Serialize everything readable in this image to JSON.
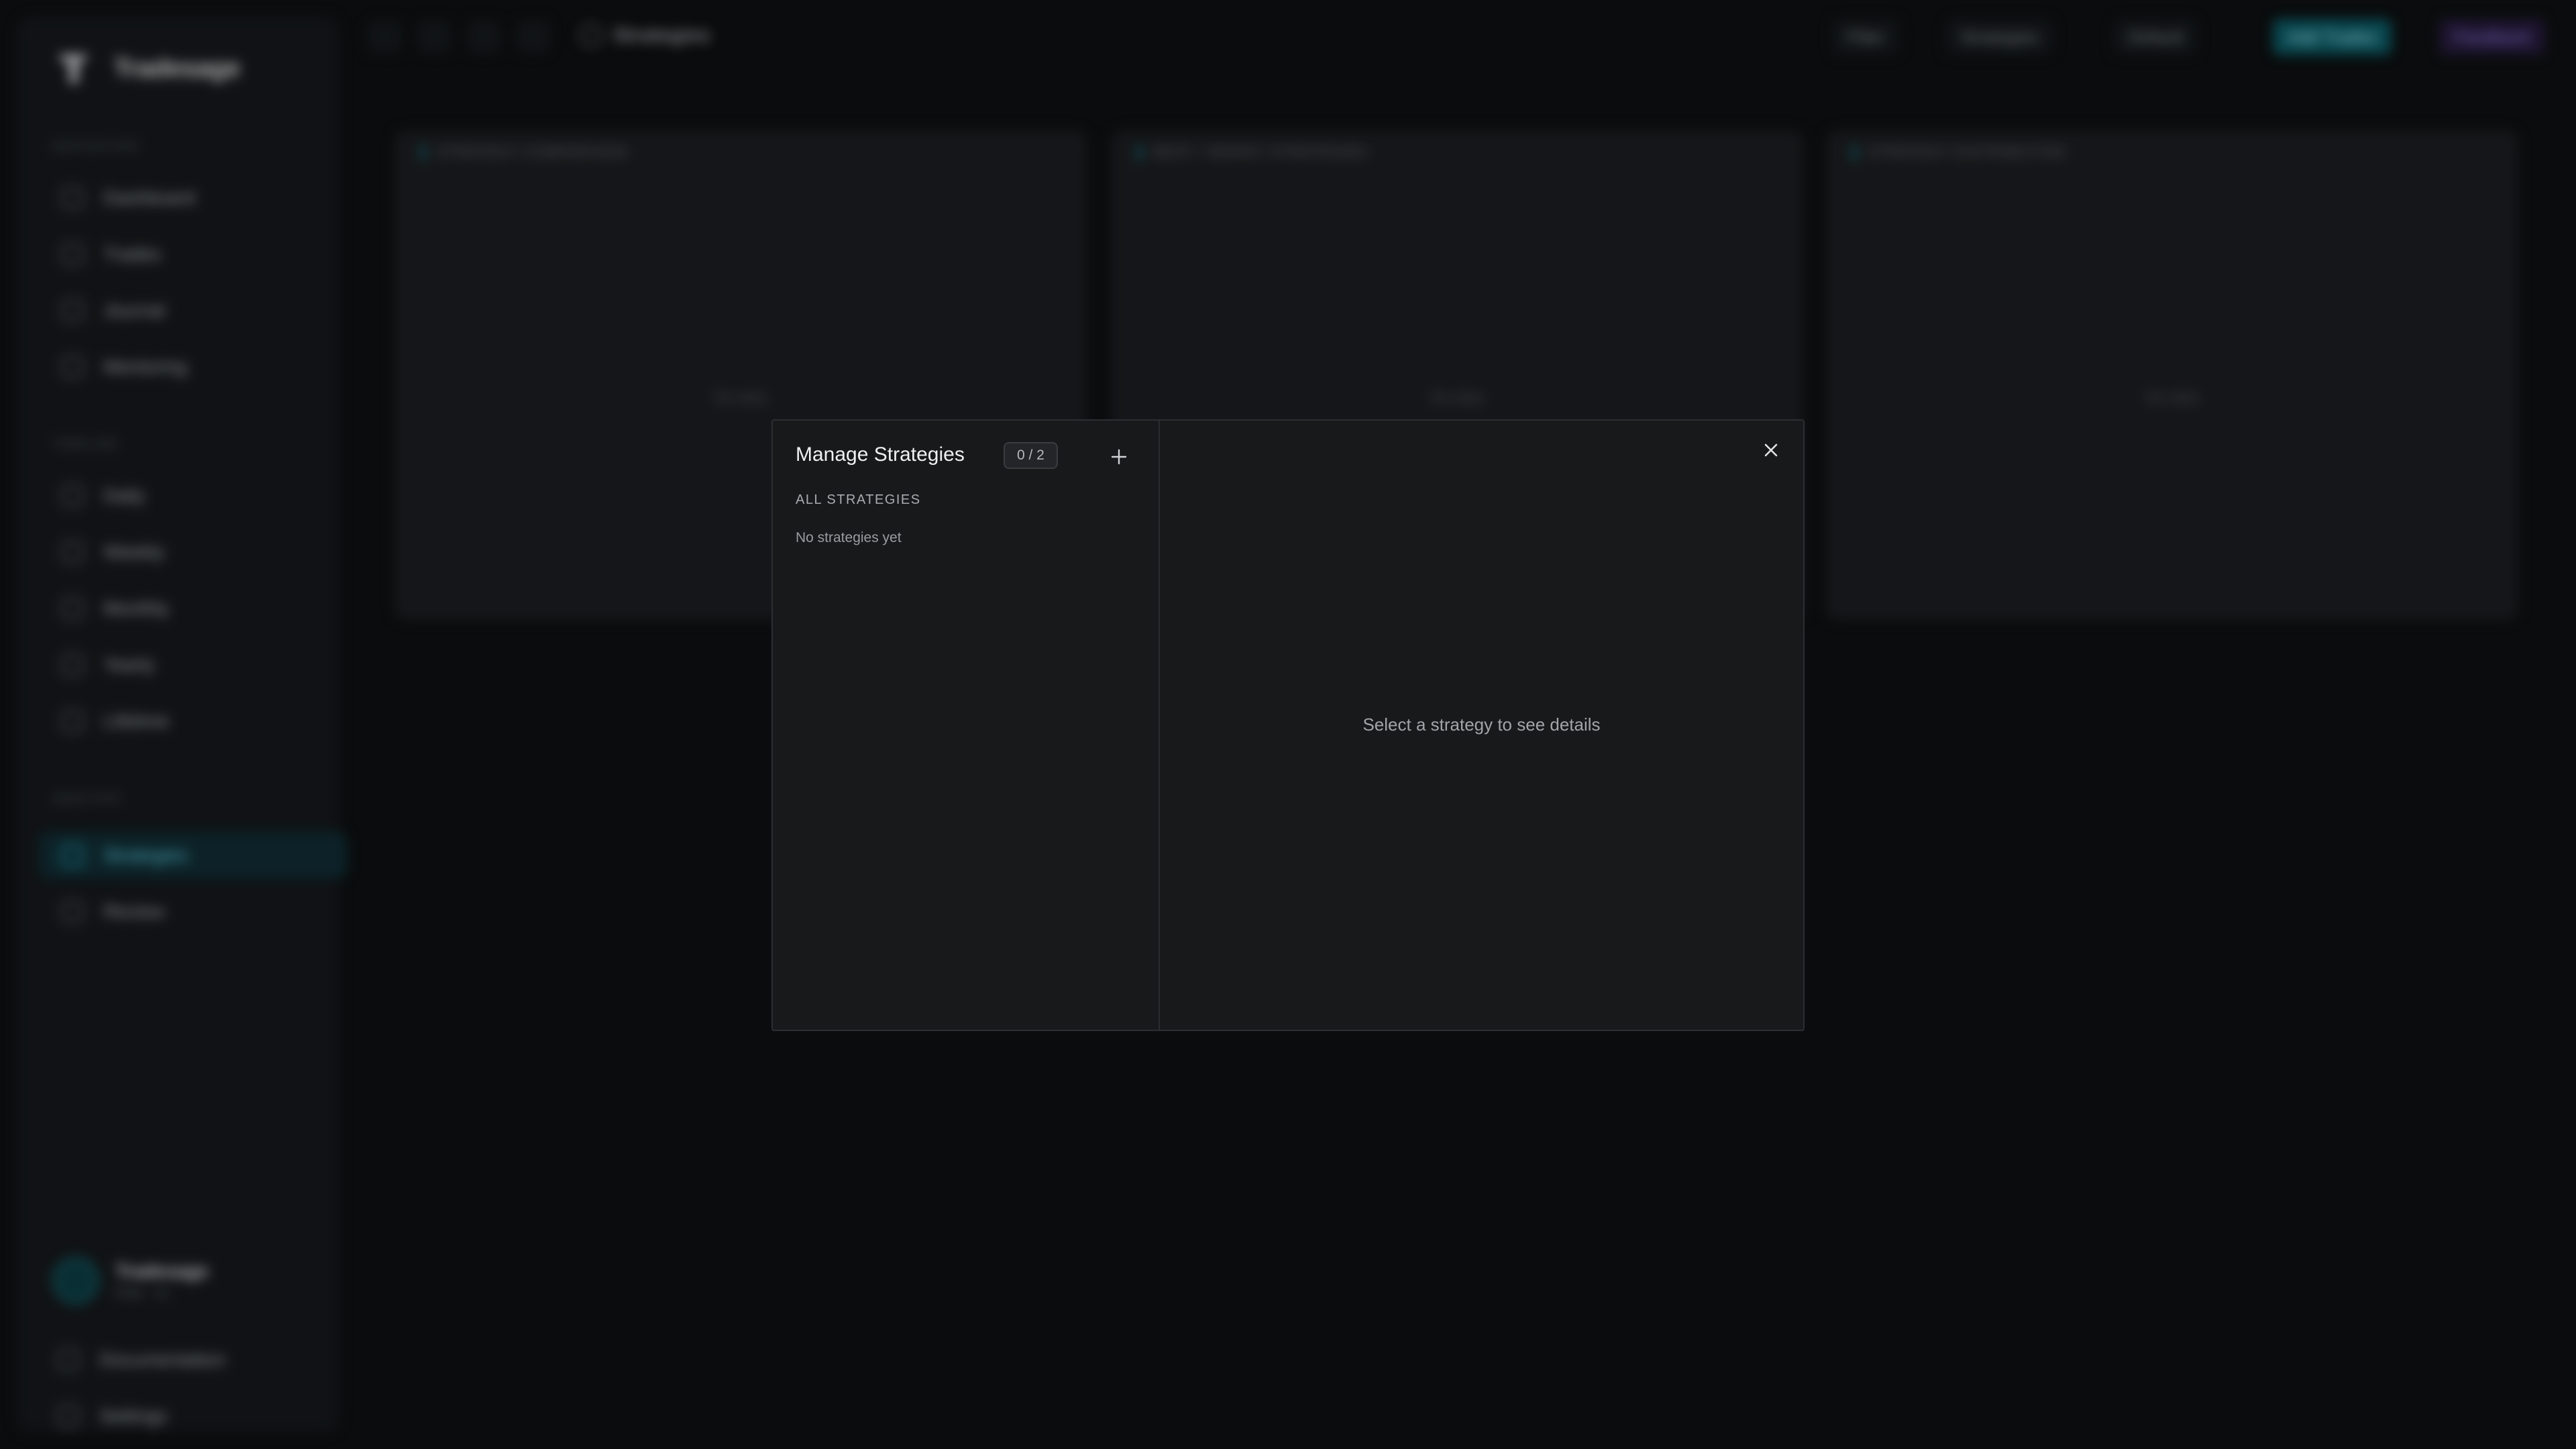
{
  "app": {
    "brand": "Tradesage",
    "breadcrumb": "Strategies"
  },
  "sidebar": {
    "sections": [
      {
        "label": "NAVIGATION"
      },
      {
        "label": "TIMELINE"
      },
      {
        "label": "ANALYSIS"
      }
    ],
    "items": [
      {
        "label": "Dashboard"
      },
      {
        "label": "Trades"
      },
      {
        "label": "Journal"
      },
      {
        "label": "Mentoring"
      },
      {
        "label": "Daily"
      },
      {
        "label": "Weekly"
      },
      {
        "label": "Monthly"
      },
      {
        "label": "Yearly"
      },
      {
        "label": "Lifetime"
      },
      {
        "label": "Strategies"
      },
      {
        "label": "Review"
      },
      {
        "label": "Documentation"
      },
      {
        "label": "Settings"
      }
    ],
    "user": {
      "name": "Tradesage",
      "plan": "Free · v1"
    }
  },
  "topbar": {
    "filter_label": "Filter",
    "strategies_label": "Strategies",
    "account_label": "Default",
    "add_trades_label": "Add Trades",
    "feedback_label": "Feedback"
  },
  "panels": [
    {
      "title": "STRATEGY COMPARISON",
      "empty": "No data"
    },
    {
      "title": "BEST / WORST STRATEGIES",
      "empty": "No data"
    },
    {
      "title": "STRATEGY DISTRIBUTION",
      "empty": "No data"
    }
  ],
  "modal": {
    "title": "Manage Strategies",
    "count": "0 / 2",
    "section_label": "ALL STRATEGIES",
    "empty_text": "No strategies yet",
    "detail_placeholder": "Select a strategy to see details"
  },
  "colors": {
    "accent": "#2cb3c9",
    "modal_bg": "#18191b",
    "app_bg": "#0d0f10"
  },
  "icons": {
    "add": "plus-icon",
    "close": "close-icon"
  }
}
